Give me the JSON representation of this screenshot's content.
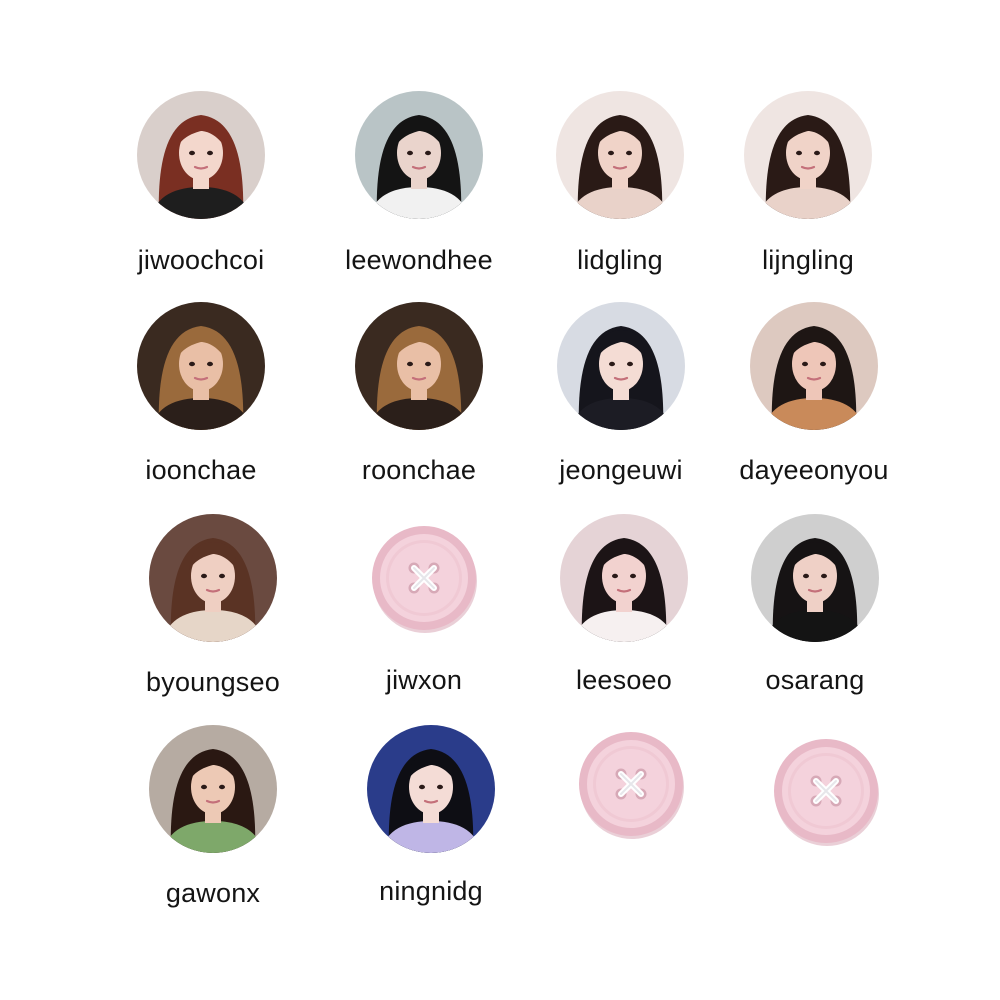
{
  "profiles": [
    {
      "username": "jiwoochcoi",
      "avatar": "photo-red-bob-hair",
      "colors": {
        "bg": "#d9cfcb",
        "hair": "#7a2f22",
        "skin": "#f3d7cc",
        "top": "#1e1e1e"
      }
    },
    {
      "username": "leewondhee",
      "avatar": "photo-glasses-dark-hair",
      "colors": {
        "bg": "#b9c4c6",
        "hair": "#141414",
        "skin": "#ead4cc",
        "top": "#f1f1f1"
      }
    },
    {
      "username": "lidgling",
      "avatar": "photo-long-dark-hair",
      "colors": {
        "bg": "#efe5e2",
        "hair": "#2a1a16",
        "skin": "#f0d3c8",
        "top": "#e9d2c9"
      }
    },
    {
      "username": "lijngling",
      "avatar": "photo-long-dark-hair",
      "colors": {
        "bg": "#efe5e2",
        "hair": "#2a1a16",
        "skin": "#f0d3c8",
        "top": "#e9d2c9"
      }
    },
    {
      "username": "ioonchae",
      "avatar": "photo-wavy-brown-hair",
      "colors": {
        "bg": "#3a2a20",
        "hair": "#9a6a3c",
        "skin": "#e9bfa6",
        "top": "#2b1f1a"
      }
    },
    {
      "username": "roonchae",
      "avatar": "photo-wavy-brown-hair",
      "colors": {
        "bg": "#3a2a20",
        "hair": "#9a6a3c",
        "skin": "#e9bfa6",
        "top": "#2b1f1a"
      }
    },
    {
      "username": "jeongeuwi",
      "avatar": "photo-black-hair-hand",
      "colors": {
        "bg": "#d7dbe3",
        "hair": "#15151c",
        "skin": "#f4dcd4",
        "top": "#1c1c24"
      }
    },
    {
      "username": "dayeeonyou",
      "avatar": "photo-closeup-bangs",
      "colors": {
        "bg": "#ddc9c0",
        "hair": "#1e1614",
        "skin": "#eec6b8",
        "top": "#c98a5a"
      }
    },
    {
      "username": "byoungseo",
      "avatar": "photo-braids",
      "colors": {
        "bg": "#6a4a40",
        "hair": "#5a3324",
        "skin": "#efcfc2",
        "top": "#e6d6c8"
      }
    },
    {
      "username": "jiwxon",
      "avatar": "pink-button-icon",
      "colors": {
        "button": "#f4d2dc",
        "rim": "#e8b9c7",
        "shadow": "#d9a8b6"
      }
    },
    {
      "username": "leesoeo",
      "avatar": "photo-peace-sign",
      "colors": {
        "bg": "#e5d3d6",
        "hair": "#1c1416",
        "skin": "#f2d2cf",
        "top": "#f6f0f0"
      }
    },
    {
      "username": "osarang",
      "avatar": "photo-choker",
      "colors": {
        "bg": "#cfcfcf",
        "hair": "#161314",
        "skin": "#efd0c6",
        "top": "#141414"
      }
    },
    {
      "username": "gawonx",
      "avatar": "photo-pose-hands",
      "colors": {
        "bg": "#b6aba2",
        "hair": "#2a1812",
        "skin": "#edc9b5",
        "top": "#7ea86a"
      }
    },
    {
      "username": "ningnidg",
      "avatar": "photo-polka-dot",
      "colors": {
        "bg": "#2a3c8a",
        "hair": "#0e0e14",
        "skin": "#f4dcd6",
        "top": "#bfb6e6"
      }
    },
    {
      "username": "",
      "avatar": "pink-button-icon",
      "colors": {
        "button": "#f4d2dc",
        "rim": "#e8b9c7",
        "shadow": "#d9a8b6"
      }
    },
    {
      "username": "",
      "avatar": "pink-button-icon",
      "colors": {
        "button": "#f4d2dc",
        "rim": "#e8b9c7",
        "shadow": "#d9a8b6"
      }
    }
  ]
}
